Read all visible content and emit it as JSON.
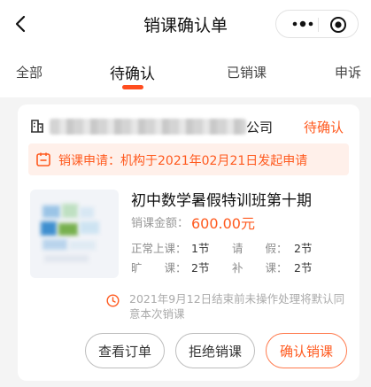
{
  "header": {
    "title": "销课确认单"
  },
  "tabs": [
    {
      "label": "全部"
    },
    {
      "label": "待确认"
    },
    {
      "label": "已销课"
    },
    {
      "label": "申诉"
    }
  ],
  "order": {
    "org_suffix": "公司",
    "status": "待确认",
    "notice": "销课申请：机构于2021年02月21日发起申请",
    "course_title": "初中数学暑假特训班第十期",
    "amount_label": "销课金额：",
    "amount_value": "600.00元",
    "stats": {
      "normal": {
        "label": "正常上课：",
        "value": "1节"
      },
      "leave": {
        "label": "请　　假：",
        "value": "2节"
      },
      "absent": {
        "label": "旷　　课：",
        "value": "2节"
      },
      "makeup": {
        "label": "补　　课：",
        "value": "2节"
      }
    },
    "deadline_text": "2021年9月12日结束前未操作处理将默认同意本次销课"
  },
  "actions": {
    "view": "查看订单",
    "reject": "拒绝销课",
    "confirm": "确认销课"
  },
  "colors": {
    "accent": "#ff5a1f",
    "notice_bg": "#fff0ea"
  }
}
